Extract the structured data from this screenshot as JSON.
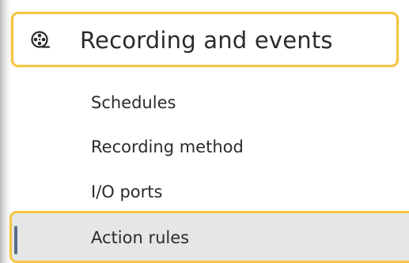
{
  "menu": {
    "section": {
      "label": "Recording and events",
      "icon": "film-reel-icon"
    },
    "items": [
      {
        "label": "Schedules"
      },
      {
        "label": "Recording method"
      },
      {
        "label": "I/O ports"
      },
      {
        "label": "Action rules",
        "selected": true
      }
    ]
  },
  "colors": {
    "highlight_border": "#f5c542",
    "selected_background": "#e6e6e6",
    "selected_indicator": "#5a6b8c",
    "text": "#2b2b2b"
  }
}
